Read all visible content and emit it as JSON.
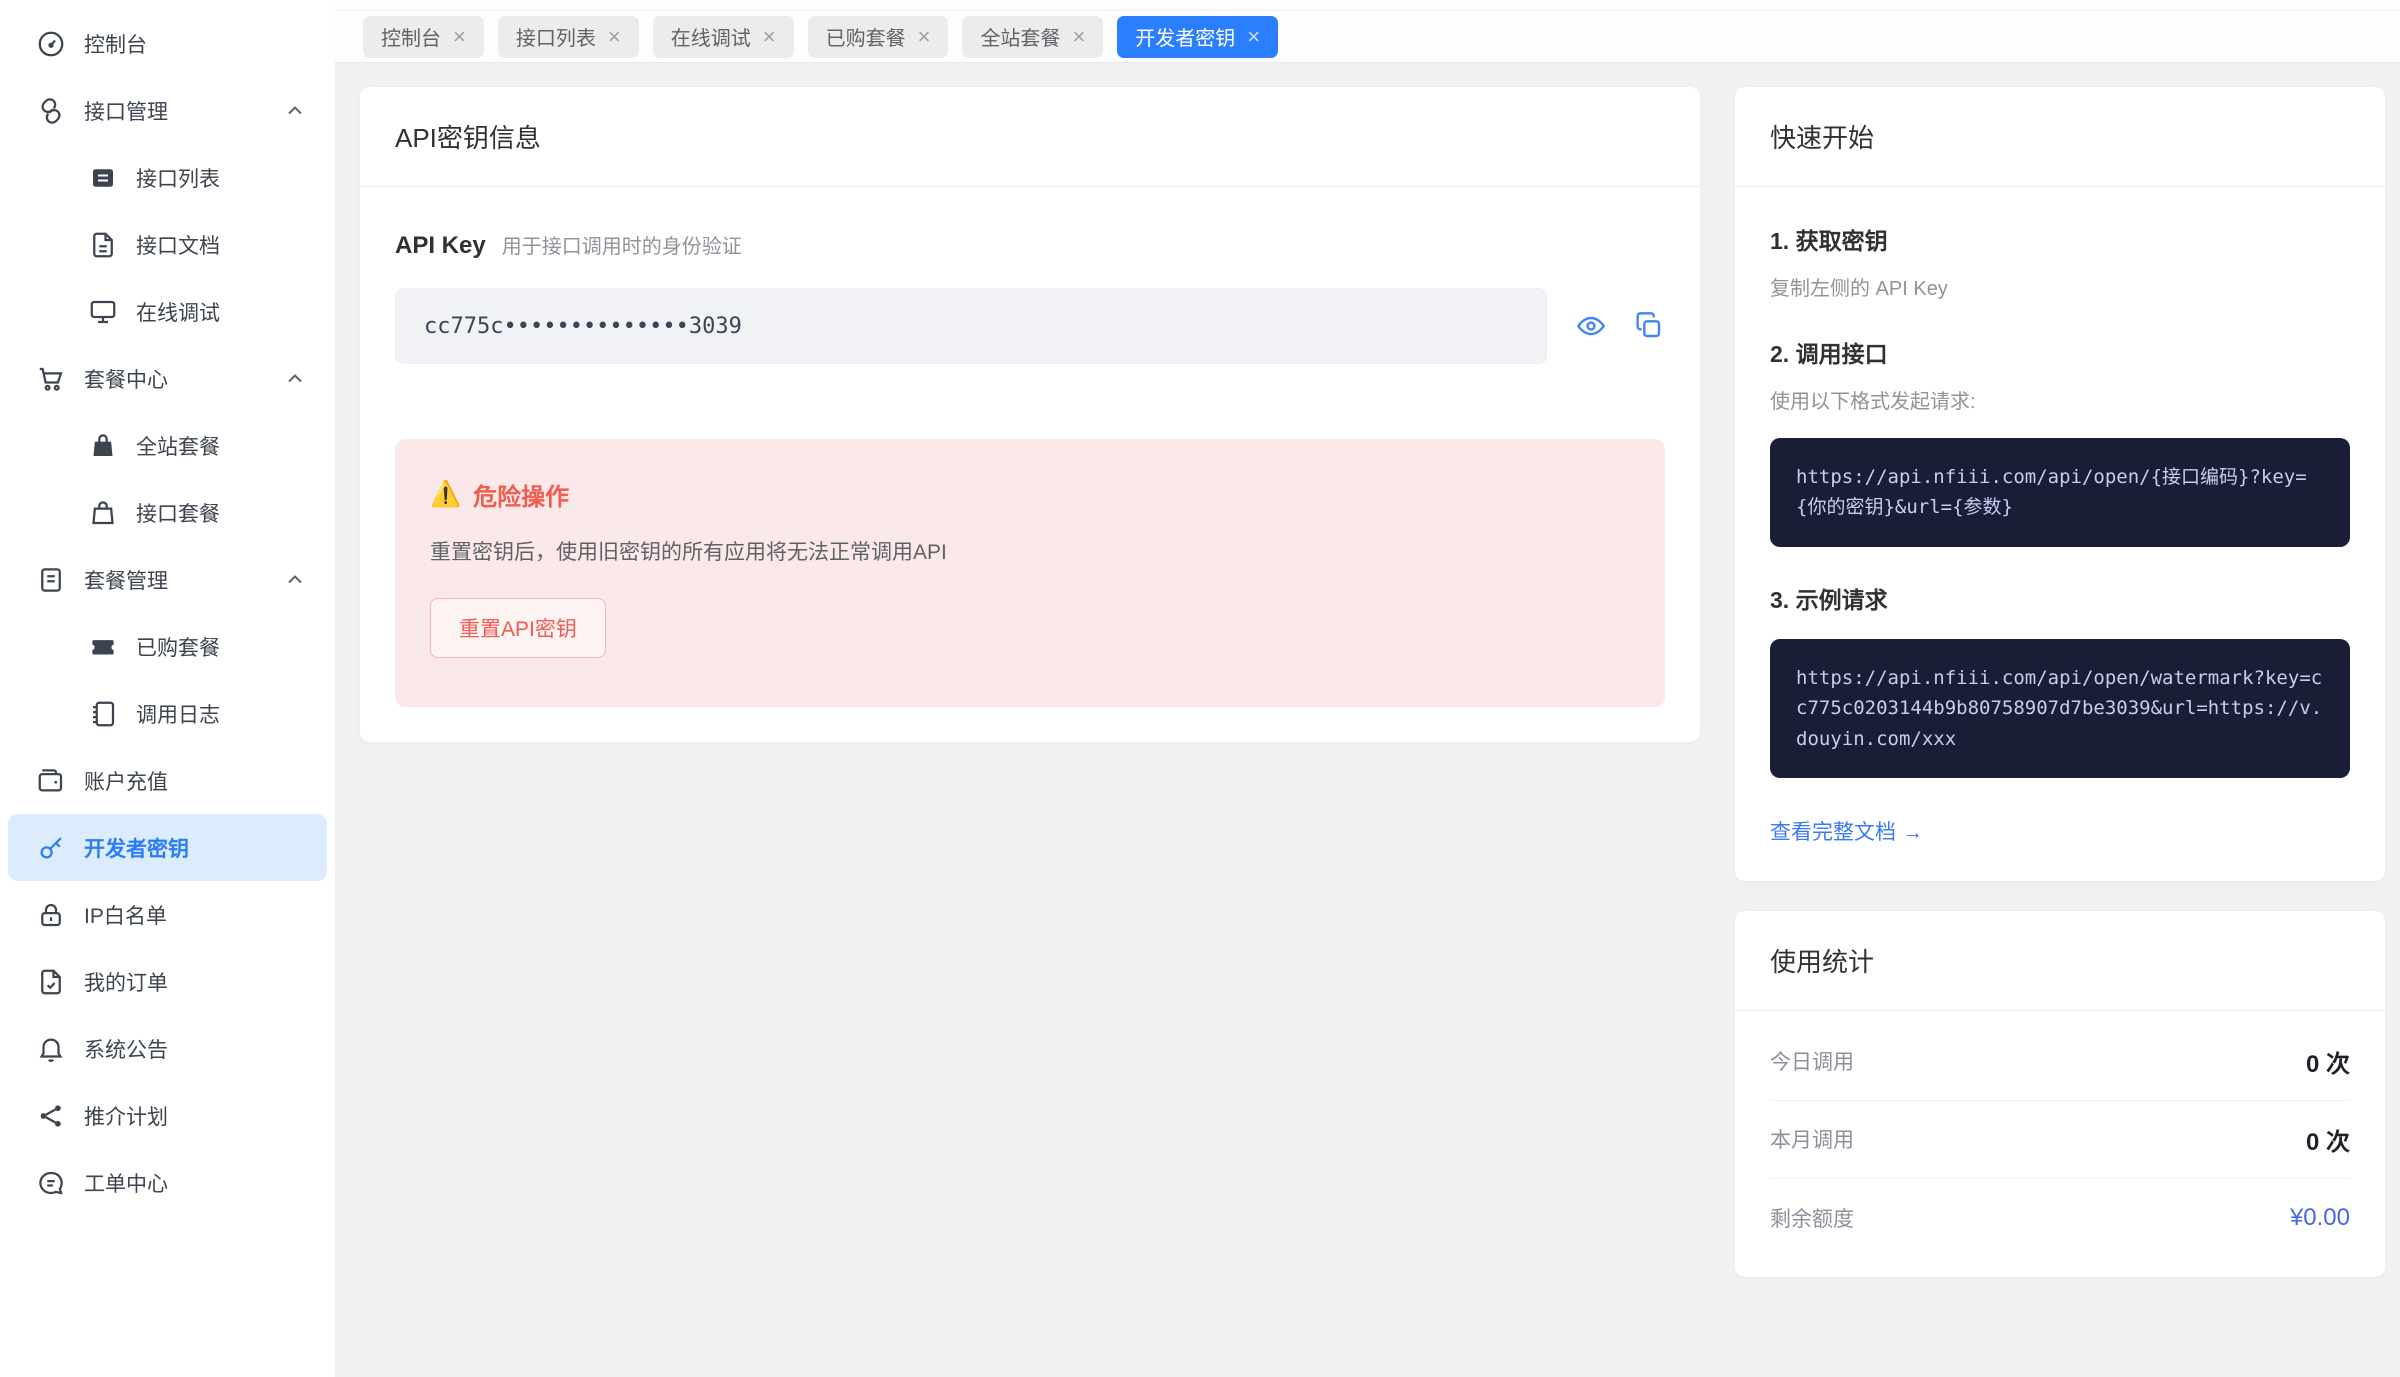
{
  "glyphs": {
    "close": "×",
    "warning": "⚠️"
  },
  "colors": {
    "accent_blue": "#2b7fff",
    "active_nav_bg": "#dcecfc",
    "danger_red": "#f25c4f",
    "danger_bg": "#fbe9e9",
    "code_bg": "#191d35",
    "link_blue": "#3a7af5",
    "balance_blue": "#4468e8"
  },
  "sidebar": {
    "items": [
      {
        "label": "控制台",
        "icon": "dashboard"
      },
      {
        "label": "接口管理",
        "icon": "api-link",
        "group": true
      },
      {
        "label": "接口列表",
        "icon": "api-list",
        "sub": true
      },
      {
        "label": "接口文档",
        "icon": "api-doc",
        "sub": true
      },
      {
        "label": "在线调试",
        "icon": "monitor",
        "sub": true
      },
      {
        "label": "套餐中心",
        "icon": "cart",
        "group": true
      },
      {
        "label": "全站套餐",
        "icon": "bag-filled",
        "sub": true
      },
      {
        "label": "接口套餐",
        "icon": "bag-outline",
        "sub": true
      },
      {
        "label": "套餐管理",
        "icon": "list-doc",
        "group": true
      },
      {
        "label": "已购套餐",
        "icon": "ticket",
        "sub": true
      },
      {
        "label": "调用日志",
        "icon": "notebook",
        "sub": true
      },
      {
        "label": "账户充值",
        "icon": "wallet"
      },
      {
        "label": "开发者密钥",
        "icon": "key",
        "active": true
      },
      {
        "label": "IP白名单",
        "icon": "lock"
      },
      {
        "label": "我的订单",
        "icon": "order-check"
      },
      {
        "label": "系统公告",
        "icon": "bell"
      },
      {
        "label": "推介计划",
        "icon": "share"
      },
      {
        "label": "工单中心",
        "icon": "chat"
      }
    ]
  },
  "tabs": [
    {
      "label": "控制台"
    },
    {
      "label": "接口列表"
    },
    {
      "label": "在线调试"
    },
    {
      "label": "已购套餐"
    },
    {
      "label": "全站套餐"
    },
    {
      "label": "开发者密钥",
      "active": true
    }
  ],
  "api_key_card": {
    "title": "API密钥信息",
    "key_label": "API Key",
    "key_hint": "用于接口调用时的身份验证",
    "key_value": "cc775c••••••••••••••3039",
    "danger": {
      "title": "危险操作",
      "description": "重置密钥后，使用旧密钥的所有应用将无法正常调用API",
      "reset_button": "重置API密钥"
    }
  },
  "quick_start": {
    "title": "快速开始",
    "steps": [
      {
        "heading": "1. 获取密钥",
        "description": "复制左侧的 API Key"
      },
      {
        "heading": "2. 调用接口",
        "description": "使用以下格式发起请求:",
        "code": "https://api.nfiii.com/api/open/{接口编码}?key={你的密钥}&url={参数}"
      },
      {
        "heading": "3. 示例请求",
        "code": "https://api.nfiii.com/api/open/watermark?key=cc775c0203144b9b80758907d7be3039&url=https://v.douyin.com/xxx"
      }
    ],
    "doc_link": "查看完整文档 →"
  },
  "usage_stats": {
    "title": "使用统计",
    "rows": [
      {
        "label": "今日调用",
        "value": "0 次"
      },
      {
        "label": "本月调用",
        "value": "0 次"
      },
      {
        "label": "剩余额度",
        "value": "¥0.00",
        "highlight": true
      }
    ]
  }
}
